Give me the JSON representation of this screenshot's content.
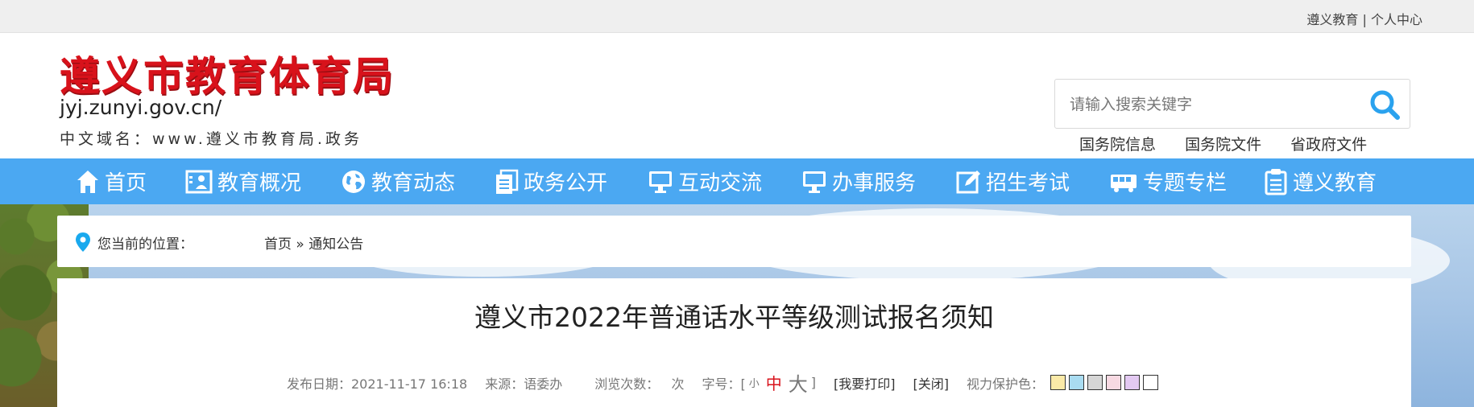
{
  "topbar": {
    "link_site": "遵义教育",
    "separator": "|",
    "link_user": "个人中心"
  },
  "header": {
    "logo_title": "遵义市教育体育局",
    "logo_domain": "jyj.zunyi.gov.cn/",
    "logo_cn_domain": "中文域名：www.遵义市教育局.政务",
    "search_placeholder": "请输入搜索关键字",
    "quicklinks": [
      "国务院信息",
      "国务院文件",
      "省政府文件"
    ]
  },
  "nav": {
    "items": [
      {
        "label": "首页",
        "icon": "home-icon"
      },
      {
        "label": "教育概况",
        "icon": "profile-icon"
      },
      {
        "label": "教育动态",
        "icon": "globe-icon"
      },
      {
        "label": "政务公开",
        "icon": "documents-icon"
      },
      {
        "label": "互动交流",
        "icon": "monitor-icon"
      },
      {
        "label": "办事服务",
        "icon": "monitor-icon"
      },
      {
        "label": "招生考试",
        "icon": "edit-icon"
      },
      {
        "label": "专题专栏",
        "icon": "bus-icon"
      },
      {
        "label": "遵义教育",
        "icon": "clipboard-icon"
      }
    ]
  },
  "breadcrumb": {
    "label": "您当前的位置：",
    "home": "首页",
    "sep": "»",
    "current": "通知公告"
  },
  "article": {
    "title": "遵义市2022年普通话水平等级测试报名须知",
    "publish": "发布日期：2021-11-17 16:18",
    "source": "来源：语委办",
    "views": "浏览次数：   次",
    "fontsize_label": "字号：[",
    "fontsize_small": "小",
    "fontsize_medium": "中",
    "fontsize_large": "大",
    "fontsize_close": "]",
    "print": "[我要打印]",
    "close": "[关闭]",
    "eye_care_label": "视力保护色：",
    "eye_care_colors": [
      "#fbeaa8",
      "#a9dcf1",
      "#d6d6d6",
      "#f7d9e2",
      "#e3c9f2",
      "#ffffff"
    ]
  },
  "colors": {
    "brand_red": "#d8121b",
    "nav_blue": "#4ba8f2",
    "search_icon": "#2aa2ee"
  }
}
